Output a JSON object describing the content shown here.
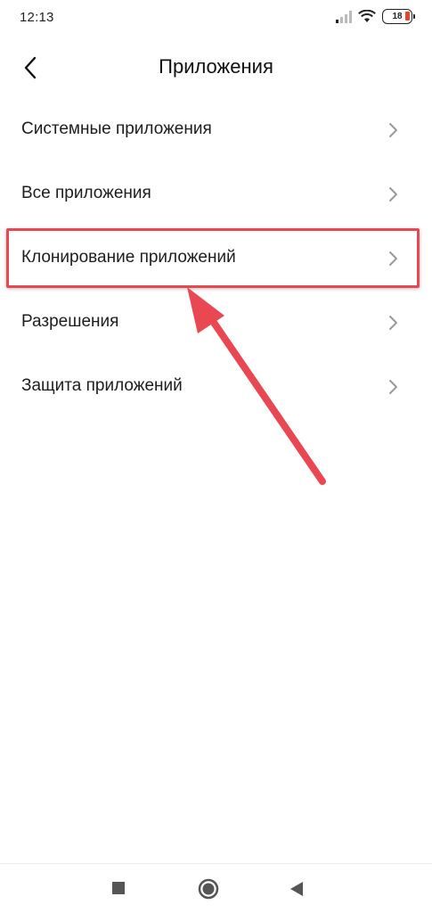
{
  "status_bar": {
    "time": "12:13",
    "battery_level": "18",
    "icons": [
      "signal-icon",
      "wifi-icon",
      "battery-icon"
    ]
  },
  "header": {
    "back_icon": "back-arrow-icon",
    "title": "Приложения"
  },
  "menu": {
    "items": [
      {
        "label": "Системные приложения"
      },
      {
        "label": "Все приложения"
      },
      {
        "label": "Клонирование приложений"
      },
      {
        "label": "Разрешения"
      },
      {
        "label": "Защита приложений"
      }
    ]
  },
  "annotation": {
    "highlighted_item": "Клонирование приложений",
    "color": "#e94751"
  },
  "nav_bar": {
    "buttons": [
      "recents-square-icon",
      "home-circle-icon",
      "back-triangle-icon"
    ]
  }
}
